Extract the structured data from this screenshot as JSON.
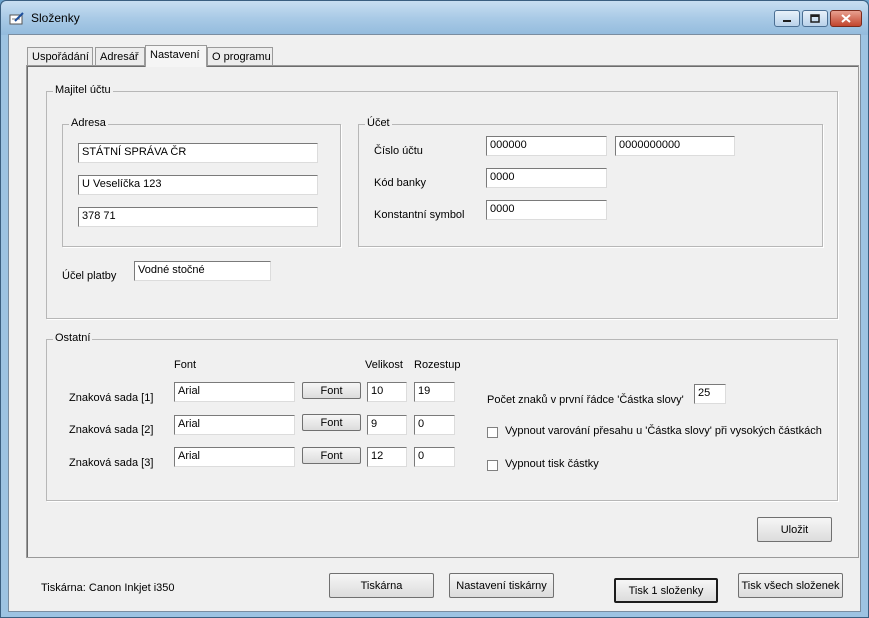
{
  "window": {
    "title": "Složenky",
    "controls": {
      "minimize": "minimize-icon",
      "maximize": "maximize-icon",
      "close": "close-icon"
    }
  },
  "tabs": [
    {
      "label": "Uspořádání",
      "active": false
    },
    {
      "label": "Adresář",
      "active": false
    },
    {
      "label": "Nastavení",
      "active": true
    },
    {
      "label": "O programu",
      "active": false
    }
  ],
  "owner_group": {
    "title": "Majitel účtu",
    "address": {
      "title": "Adresa",
      "line1": "STÁTNÍ SPRÁVA ČR",
      "line2": "U Veselíčka 123",
      "line3": "378 71"
    },
    "account": {
      "title": "Účet",
      "account_number_label": "Číslo účtu",
      "account_prefix": "000000",
      "account_number": "0000000000",
      "bank_code_label": "Kód banky",
      "bank_code": "0000",
      "constant_symbol_label": "Konstantní symbol",
      "constant_symbol": "0000"
    },
    "purpose_label": "Účel platby",
    "purpose_value": "Vodné stočné"
  },
  "other_group": {
    "title": "Ostatní",
    "font_header": "Font",
    "size_header": "Velikost",
    "spacing_header": "Rozestup",
    "font_button_label": "Font",
    "charsets": [
      {
        "label": "Znaková sada [1]",
        "font": "Arial",
        "size": "10",
        "spacing": "19"
      },
      {
        "label": "Znaková sada [2]",
        "font": "Arial",
        "size": "9",
        "spacing": "0"
      },
      {
        "label": "Znaková sada [3]",
        "font": "Arial",
        "size": "12",
        "spacing": "0"
      }
    ],
    "char_count_label": "Počet znaků v první řádce 'Částka slovy'",
    "char_count_value": "25",
    "disable_overflow_warning_label": "Vypnout varování přesahu  u 'Částka slovy' při vysokých částkách",
    "disable_overflow_warning_checked": false,
    "disable_amount_print_label": "Vypnout tisk částky",
    "disable_amount_print_checked": false
  },
  "save_button": "Uložit",
  "footer": {
    "printer_status": "Tiskárna: Canon Inkjet i350",
    "printer_button": "Tiskárna",
    "printer_settings_button": "Nastavení tiskárny",
    "print_one_button": "Tisk 1 složenky",
    "print_all_button": "Tisk všech složenek"
  }
}
